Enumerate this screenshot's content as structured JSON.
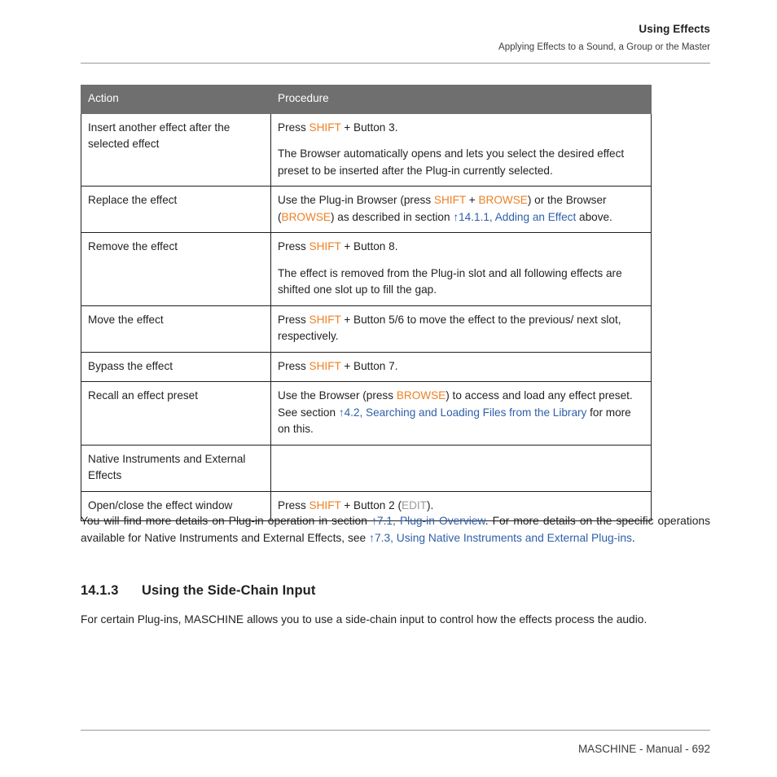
{
  "header": {
    "title": "Using Effects",
    "subtitle": "Applying Effects to a Sound, a Group or the Master"
  },
  "table": {
    "columns": [
      "Action",
      "Procedure"
    ],
    "rows": [
      {
        "action": "Insert another effect after the selected effect",
        "action_bold": false,
        "procedure_paragraphs": [
          [
            {
              "t": "Press ",
              "s": "plain"
            },
            {
              "t": "SHIFT",
              "s": "key"
            },
            {
              "t": " + Button 3.",
              "s": "plain"
            }
          ],
          [
            {
              "t": "The Browser automatically opens and lets you select the desired effect preset to be inserted after the Plug-in currently selected.",
              "s": "plain"
            }
          ]
        ]
      },
      {
        "action": "Replace the effect",
        "action_bold": false,
        "procedure_paragraphs": [
          [
            {
              "t": "Use the Plug-in Browser (press ",
              "s": "plain"
            },
            {
              "t": "SHIFT",
              "s": "key"
            },
            {
              "t": " + ",
              "s": "plain"
            },
            {
              "t": "BROWSE",
              "s": "key"
            },
            {
              "t": ") or the Browser (",
              "s": "plain"
            },
            {
              "t": "BROWSE",
              "s": "key"
            },
            {
              "t": ") as described in section ",
              "s": "plain"
            },
            {
              "t": "↑14.1.1, Adding an Effect",
              "s": "link"
            },
            {
              "t": " above.",
              "s": "plain"
            }
          ]
        ]
      },
      {
        "action": "Remove the effect",
        "action_bold": false,
        "procedure_paragraphs": [
          [
            {
              "t": "Press ",
              "s": "plain"
            },
            {
              "t": "SHIFT",
              "s": "key"
            },
            {
              "t": " + Button 8.",
              "s": "plain"
            }
          ],
          [
            {
              "t": "The effect is removed from the Plug-in slot and all following effects are shifted one slot up to fill the gap.",
              "s": "plain"
            }
          ]
        ]
      },
      {
        "action": "Move the effect",
        "action_bold": false,
        "procedure_paragraphs": [
          [
            {
              "t": "Press ",
              "s": "plain"
            },
            {
              "t": "SHIFT",
              "s": "key"
            },
            {
              "t": " + Button 5/6 to move the effect to the previous/ next slot, respectively.",
              "s": "plain"
            }
          ]
        ]
      },
      {
        "action": "Bypass the effect",
        "action_bold": false,
        "procedure_paragraphs": [
          [
            {
              "t": "Press ",
              "s": "plain"
            },
            {
              "t": "SHIFT",
              "s": "key"
            },
            {
              "t": " + Button 7.",
              "s": "plain"
            }
          ]
        ]
      },
      {
        "action": "Recall an effect preset",
        "action_bold": false,
        "procedure_paragraphs": [
          [
            {
              "t": "Use the Browser (press ",
              "s": "plain"
            },
            {
              "t": "BROWSE",
              "s": "key"
            },
            {
              "t": ") to access and load any effect preset. See section ",
              "s": "plain"
            },
            {
              "t": "↑4.2, Searching and Loading Files from the Library",
              "s": "link"
            },
            {
              "t": " for more on this.",
              "s": "plain"
            }
          ]
        ]
      },
      {
        "action": "Native Instruments and External Effects",
        "action_bold": true,
        "procedure_paragraphs": []
      },
      {
        "action": "Open/close the effect window",
        "action_bold": false,
        "procedure_paragraphs": [
          [
            {
              "t": "Press ",
              "s": "plain"
            },
            {
              "t": "SHIFT",
              "s": "key"
            },
            {
              "t": " + Button 2 (",
              "s": "plain"
            },
            {
              "t": "EDIT",
              "s": "key-dim"
            },
            {
              "t": ").",
              "s": "plain"
            }
          ]
        ]
      }
    ]
  },
  "body": {
    "paragraph_reference": [
      {
        "t": "You will find more details on Plug-in operation in section ",
        "s": "plain"
      },
      {
        "t": "↑7.1, Plug-in Overview",
        "s": "link"
      },
      {
        "t": ". For more details on the specific operations available for Native Instruments and External Effects, see ",
        "s": "plain"
      },
      {
        "t": "↑7.3, Using Native Instruments and External Plug-ins",
        "s": "link"
      },
      {
        "t": ".",
        "s": "plain"
      }
    ],
    "heading": {
      "number": "14.1.3",
      "title": "Using the Side-Chain Input"
    },
    "paragraph_last": [
      {
        "t": "For certain Plug-ins, MASCHINE allows you to use a side-chain input to control how the effects process the audio.",
        "s": "plain"
      }
    ]
  },
  "footer": {
    "text": "MASCHINE - Manual - 692"
  },
  "colors": {
    "key_orange": "#ee8126",
    "key_dim_gray": "#9b9b9b",
    "link_blue": "#2f5fa8",
    "table_header_gray": "#706f6f",
    "text_black": "#231f20",
    "rule_gray": "#9a9a9a"
  }
}
